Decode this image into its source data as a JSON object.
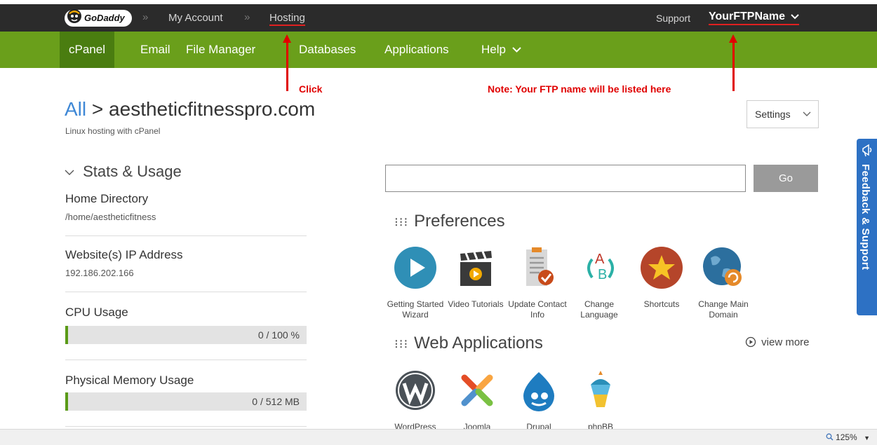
{
  "topbar": {
    "logo_text": "GoDaddy",
    "crumb_sep": "»",
    "my_account": "My Account",
    "hosting": "Hosting",
    "support": "Support",
    "username": "YourFTPName",
    "username_chevron": "chevron-down-icon"
  },
  "nav": {
    "items": [
      "cPanel",
      "Email",
      "File Manager",
      "Databases",
      "Applications",
      "Help"
    ],
    "help_chevron": "chevron-down-icon",
    "active": "cPanel"
  },
  "annotations": {
    "click": "Click",
    "note": "Note: Your FTP name will be listed here"
  },
  "header": {
    "all_link": "All",
    "sep": ">",
    "domain": "aestheticfitnesspro.com",
    "subtitle": "Linux hosting with cPanel",
    "settings": "Settings"
  },
  "stats": {
    "title": "Stats & Usage",
    "home_dir_label": "Home Directory",
    "home_dir_value": "/home/aestheticfitness",
    "ip_label": "Website(s) IP Address",
    "ip_value": "192.186.202.166",
    "cpu_label": "CPU Usage",
    "cpu_value": "0 / 100 %",
    "cpu_fraction": 0,
    "mem_label": "Physical Memory Usage",
    "mem_value": "0 / 512 MB",
    "mem_fraction": 0
  },
  "search": {
    "value": "",
    "go": "Go"
  },
  "preferences": {
    "title": "Preferences",
    "apps": [
      {
        "label": "Getting Started Wizard",
        "icon": "play-icon"
      },
      {
        "label": "Video Tutorials",
        "icon": "clapperboard-icon"
      },
      {
        "label": "Update Contact Info",
        "icon": "clipboard-icon"
      },
      {
        "label": "Change Language",
        "icon": "language-icon"
      },
      {
        "label": "Shortcuts",
        "icon": "star-icon"
      },
      {
        "label": "Change Main Domain",
        "icon": "globe-icon"
      }
    ]
  },
  "web_apps": {
    "title": "Web Applications",
    "view_more": "view more",
    "apps": [
      {
        "label": "WordPress",
        "icon": "wordpress-icon"
      },
      {
        "label": "Joomla",
        "icon": "joomla-icon"
      },
      {
        "label": "Drupal",
        "icon": "drupal-icon"
      },
      {
        "label": "phpBB",
        "icon": "phpbb-icon"
      }
    ]
  },
  "feedback": {
    "label": "Feedback & Support"
  },
  "statusbar": {
    "zoom": "125%"
  },
  "colors": {
    "topbar": "#2b2b2b",
    "nav_green": "#6a9f1b",
    "nav_active": "#4a7d10",
    "link_blue": "#3f88d6",
    "annotation_red": "#e00000",
    "feedback_blue": "#2d71c4"
  }
}
